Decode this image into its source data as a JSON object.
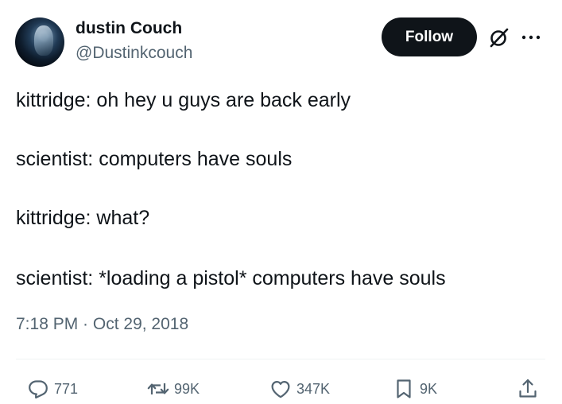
{
  "author": {
    "display_name": "dustin Couch",
    "handle": "@Dustinkcouch"
  },
  "header": {
    "follow_label": "Follow",
    "grok_icon": "circle-slash-icon",
    "more_icon": "more-horizontal-icon"
  },
  "tweet": {
    "lines": [
      "kittridge: oh hey u guys are back early",
      "scientist: computers have souls",
      "kittridge: what?",
      "scientist: *loading a pistol* computers have souls"
    ],
    "time": "7:18 PM",
    "separator": " · ",
    "date": "Oct 29, 2018"
  },
  "actions": {
    "replies": "771",
    "reposts": "99K",
    "likes": "347K",
    "bookmarks": "9K",
    "icons": [
      "reply-icon",
      "repost-icon",
      "like-icon",
      "bookmark-icon",
      "share-icon"
    ]
  },
  "colors": {
    "primary_text": "#0f1419",
    "secondary_text": "#536471",
    "follow_bg": "#0f1419",
    "divider": "#eff3f4"
  }
}
